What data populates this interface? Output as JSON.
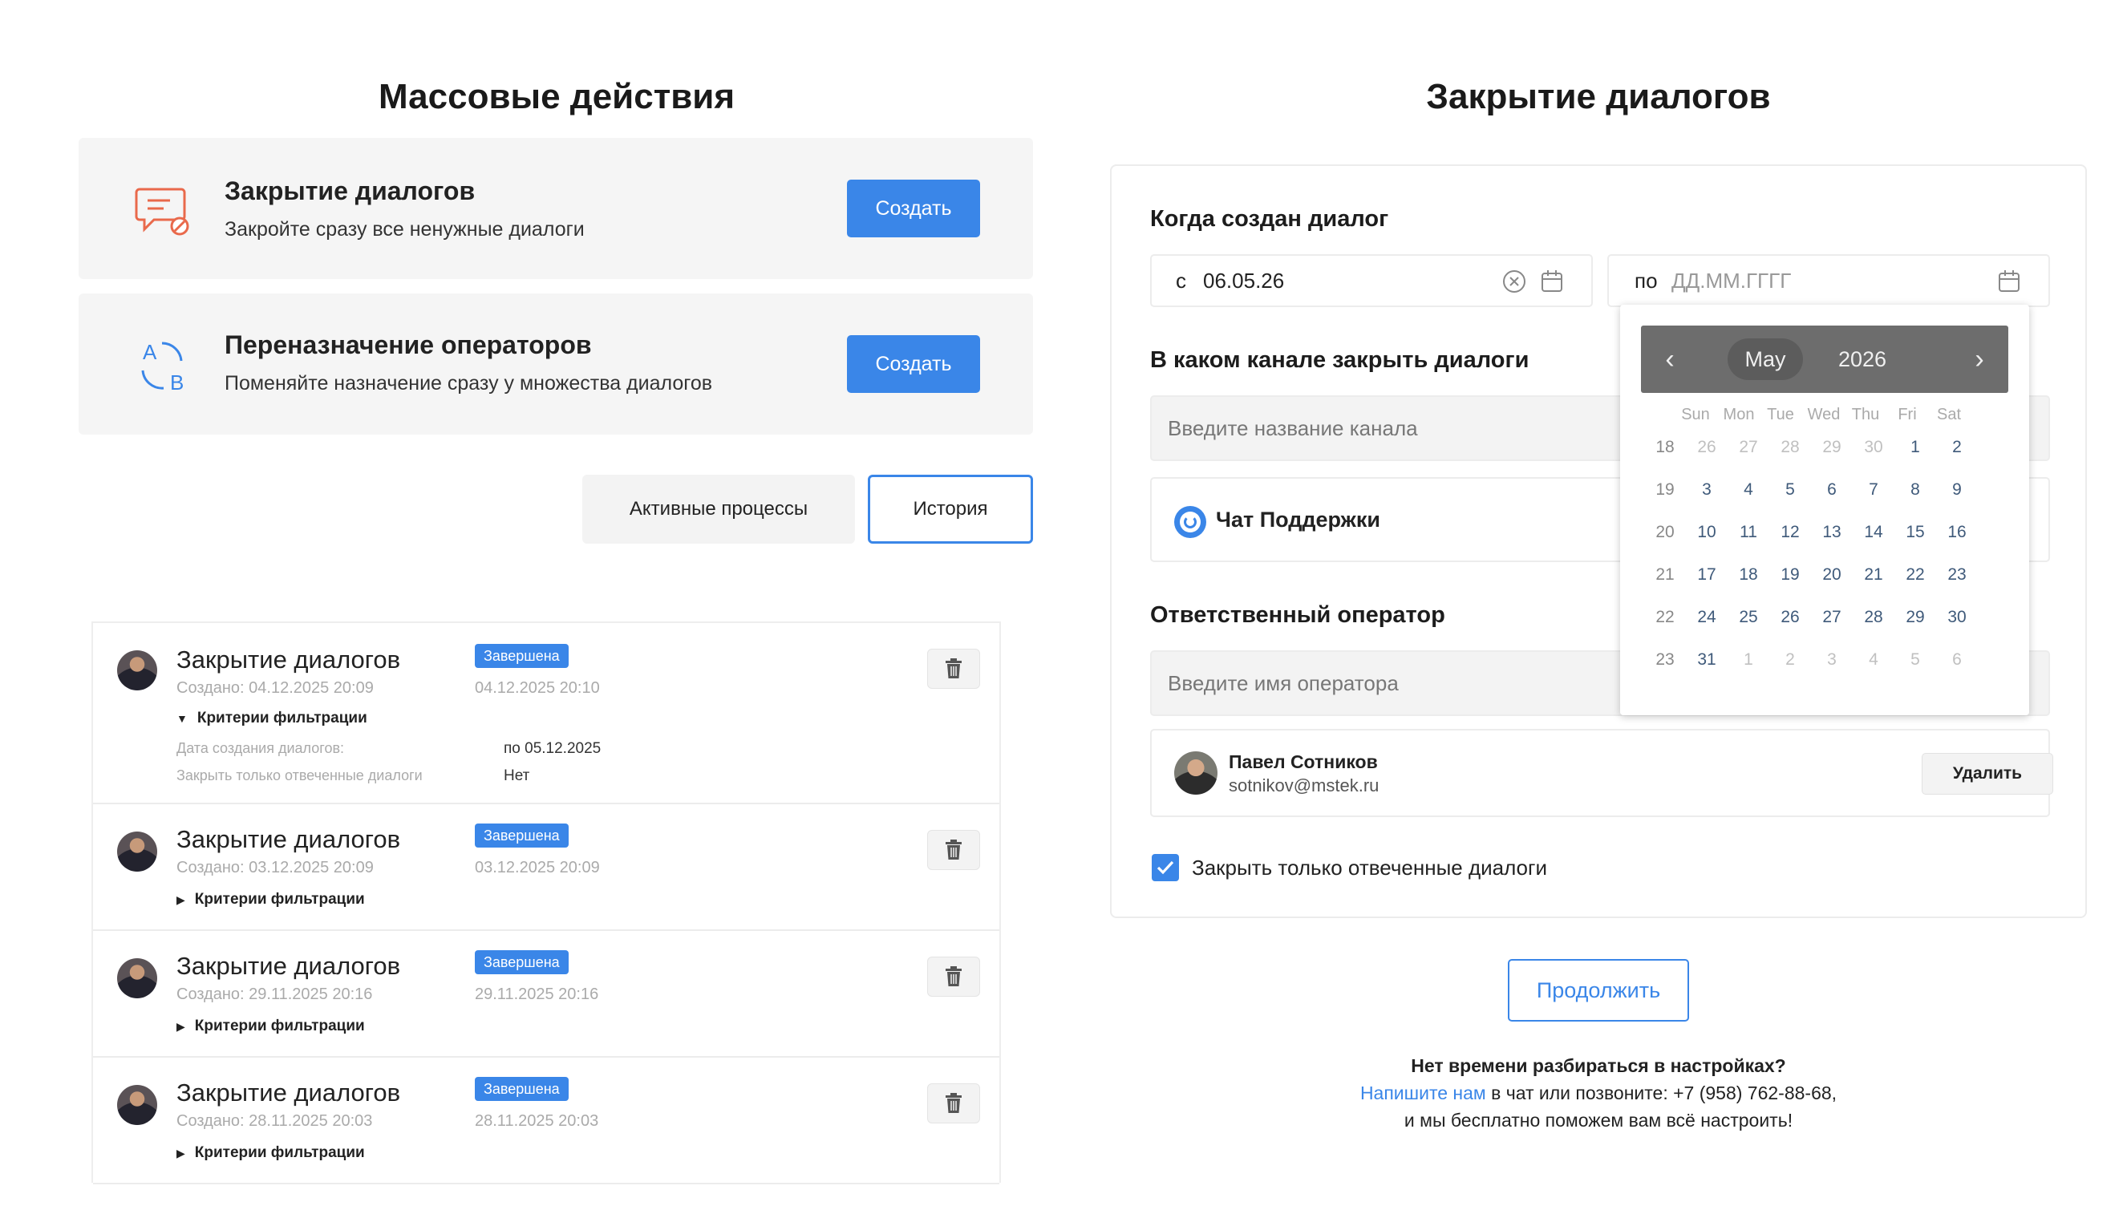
{
  "left": {
    "title": "Массовые действия",
    "cards": [
      {
        "title": "Закрытие диалогов",
        "desc": "Закройте сразу все ненужные диалоги",
        "button": "Создать"
      },
      {
        "title": "Переназначение операторов",
        "desc": "Поменяйте назначение сразу у множества диалогов",
        "button": "Создать"
      }
    ],
    "tabs": {
      "active_processes": "Активные процессы",
      "history": "История"
    },
    "history": [
      {
        "title": "Закрытие диалогов",
        "status": "Завершена",
        "created": "Создано: 04.12.2025 20:09",
        "finished": "04.12.2025 20:10",
        "criteria": "Критерии фильтрации",
        "expanded": true,
        "details": [
          {
            "label": "Дата создания диалогов:",
            "value": "по 05.12.2025"
          },
          {
            "label": "Закрыть только отвеченные диалоги",
            "value": "Нет"
          }
        ]
      },
      {
        "title": "Закрытие диалогов",
        "status": "Завершена",
        "created": "Создано: 03.12.2025 20:09",
        "finished": "03.12.2025 20:09",
        "criteria": "Критерии фильтрации"
      },
      {
        "title": "Закрытие диалогов",
        "status": "Завершена",
        "created": "Создано: 29.11.2025 20:16",
        "finished": "29.11.2025 20:16",
        "criteria": "Критерии фильтрации"
      },
      {
        "title": "Закрытие диалогов",
        "status": "Завершена",
        "created": "Создано: 28.11.2025 20:03",
        "finished": "28.11.2025 20:03",
        "criteria": "Критерии фильтрации"
      }
    ]
  },
  "right": {
    "title": "Закрытие диалогов",
    "when_created": "Когда создан диалог",
    "from_prefix": "с",
    "from_value": "06.05.26",
    "to_prefix": "по",
    "to_placeholder": "ДД.ММ.ГГГГ",
    "channel_label": "В каком канале закрыть диалоги",
    "channel_placeholder": "Введите название канала",
    "channel_item": "Чат Поддержки",
    "operator_label": "Ответственный оператор",
    "operator_placeholder": "Введите имя оператора",
    "operator": {
      "name": "Павел Сотников",
      "email": "sotnikov@mstek.ru",
      "remove": "Удалить"
    },
    "checkbox_label": "Закрыть только отвеченные диалоги",
    "checkbox_checked": true,
    "continue": "Продолжить",
    "footer": {
      "line1": "Нет времени разбираться в настройках?",
      "link": "Напишите нам",
      "line2_rest": " в чат или позвоните: +7 (958) 762-88-68,",
      "line3": "и мы бесплатно поможем вам всё настроить!"
    }
  },
  "calendar": {
    "month": "May",
    "year": "2026",
    "prev": "‹",
    "next": "›",
    "weekdays": [
      "Sun",
      "Mon",
      "Tue",
      "Wed",
      "Thu",
      "Fri",
      "Sat"
    ],
    "weeks": [
      [
        {
          "d": "18",
          "m": 0
        },
        {
          "d": "26",
          "m": -1
        },
        {
          "d": "27",
          "m": -1
        },
        {
          "d": "28",
          "m": -1
        },
        {
          "d": "29",
          "m": -1
        },
        {
          "d": "30",
          "m": -1
        },
        {
          "d": "1",
          "m": 0
        }
      ],
      [
        {
          "d": "2",
          "m": 0
        },
        {
          "d": "19",
          "m": 0
        },
        {
          "d": "3",
          "m": 0
        },
        {
          "d": "4",
          "m": 0
        },
        {
          "d": "5",
          "m": 0
        },
        {
          "d": "6",
          "m": 0
        },
        {
          "d": "7",
          "m": 0
        }
      ],
      [
        {
          "d": "8",
          "m": 0
        },
        {
          "d": "9",
          "m": 0
        },
        {
          "d": "20",
          "m": 0
        },
        {
          "d": "10",
          "m": 0
        },
        {
          "d": "11",
          "m": 0
        },
        {
          "d": "12",
          "m": 0
        },
        {
          "d": "13",
          "m": 0
        }
      ],
      [
        {
          "d": "14",
          "m": 0
        },
        {
          "d": "15",
          "m": 0
        },
        {
          "d": "16",
          "m": 0
        },
        {
          "d": "21",
          "m": 0
        },
        {
          "d": "17",
          "m": 0
        },
        {
          "d": "18",
          "m": 0
        },
        {
          "d": "19",
          "m": 0
        }
      ],
      [
        {
          "d": "20",
          "m": 0
        },
        {
          "d": "21",
          "m": 0
        },
        {
          "d": "22",
          "m": 0
        },
        {
          "d": "23",
          "m": 0
        },
        {
          "d": "22",
          "m": 0
        },
        {
          "d": "24",
          "m": 0
        },
        {
          "d": "25",
          "m": 0
        }
      ],
      [
        {
          "d": "26",
          "m": 0
        },
        {
          "d": "27",
          "m": 0
        },
        {
          "d": "28",
          "m": 0
        },
        {
          "d": "29",
          "m": 0
        },
        {
          "d": "30",
          "m": 0
        },
        {
          "d": "23",
          "m": 0
        },
        {
          "d": "31",
          "m": 0
        }
      ],
      [
        {
          "d": "1",
          "m": 1
        },
        {
          "d": "2",
          "m": 1
        },
        {
          "d": "3",
          "m": 1
        },
        {
          "d": "4",
          "m": 1
        },
        {
          "d": "5",
          "m": 1
        },
        {
          "d": "6",
          "m": 1
        },
        {
          "d": "",
          "m": 1
        }
      ]
    ],
    "colors": {
      "current": "#3f5a7a",
      "muted": "#c0c0c0"
    }
  },
  "colors": {
    "accent": "#3a86e8",
    "icon_orange": "#e9694b",
    "icon_blue": "#3a86e8"
  }
}
